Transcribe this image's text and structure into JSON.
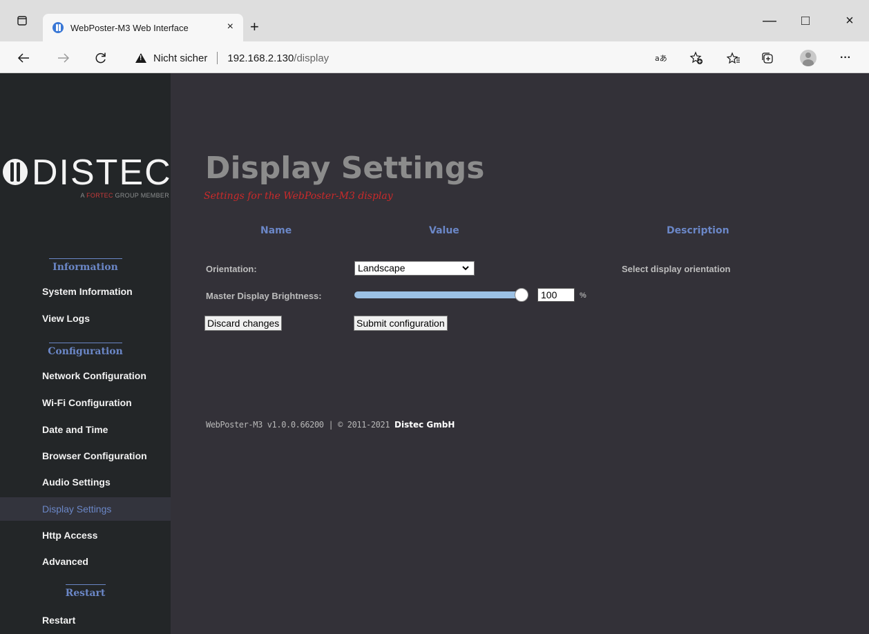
{
  "browser": {
    "tab_title": "WebPoster-M3 Web Interface",
    "tab_close": "×",
    "new_tab": "+",
    "insecure_label": "Nicht sicher",
    "url_host": "192.168.2.130",
    "url_path": "/display",
    "window_controls": {
      "minimize": "—",
      "maximize": "□",
      "close": "×"
    },
    "more": "···"
  },
  "logo": {
    "text": "DISTEC",
    "sub_prefix": "A ",
    "sub_accent": "FORTEC",
    "sub_suffix": " GROUP MEMBER"
  },
  "sidebar": {
    "information_heading": "Information",
    "information_items": [
      "System Information",
      "View Logs"
    ],
    "configuration_heading": "Configuration",
    "configuration_items": [
      "Network Configuration",
      "Wi-Fi Configuration",
      "Date and Time",
      "Browser Configuration",
      "Audio Settings",
      "Display Settings",
      "Http Access",
      "Advanced"
    ],
    "active_item": "Display Settings",
    "restart_heading": "Restart",
    "restart_items": [
      "Restart"
    ]
  },
  "main": {
    "title": "Display Settings",
    "subtitle": "Settings for the WebPoster-M3 display",
    "columns": {
      "name": "Name",
      "value": "Value",
      "description": "Description"
    },
    "orientation": {
      "label": "Orientation:",
      "value": "Landscape",
      "description": "Select display orientation"
    },
    "brightness": {
      "label": "Master Display Brightness:",
      "value": "100",
      "unit": "%",
      "level_fraction": 1.0
    },
    "buttons": {
      "discard": "Discard changes",
      "submit": "Submit configuration"
    },
    "footer": {
      "text": "WebPoster-M3 v1.0.0.66200 | © 2011-2021 ",
      "company": "Distec GmbH"
    }
  },
  "colors": {
    "page_bg": "#333138",
    "sidebar_bg": "#232628",
    "accent_blue": "#6b87c7",
    "subtitle_red": "#cc2a2a",
    "title_gray": "#8c8c8c"
  },
  "icons": [
    "tab-actions-icon",
    "favicon-icon",
    "back-icon",
    "forward-icon",
    "refresh-icon",
    "warning-icon",
    "read-aloud-icon",
    "add-favorite-icon",
    "favorites-icon",
    "collections-icon",
    "profile-icon",
    "more-icon"
  ]
}
